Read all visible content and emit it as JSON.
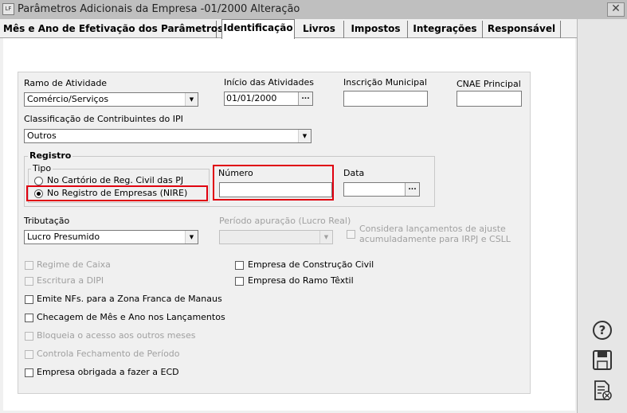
{
  "window": {
    "title": "Parâmetros Adicionais da Empresa -01/2000 Alteração",
    "app_badge": "LF",
    "close_label": "✕"
  },
  "tabs": [
    {
      "label": "Mês e Ano de Efetivação dos Parâmetros",
      "active": false
    },
    {
      "label": "Identificação",
      "active": true
    },
    {
      "label": "Livros",
      "active": false
    },
    {
      "label": "Impostos",
      "active": false
    },
    {
      "label": "Integrações",
      "active": false
    },
    {
      "label": "Responsável",
      "active": false
    }
  ],
  "form": {
    "ramo_label": "Ramo de Atividade",
    "ramo_value": "Comércio/Serviços",
    "inicio_label": "Início das Atividades",
    "inicio_value": "01/01/2000",
    "inscricao_label": "Inscrição Municipal",
    "inscricao_value": "",
    "cnae_label": "CNAE Principal",
    "cnae_value": "",
    "classificacao_label": "Classificação de Contribuintes do IPI",
    "classificacao_value": "Outros",
    "registro_title": "Registro",
    "tipo_title": "Tipo",
    "tipo_option1": "No Cartório de Reg. Civil das PJ",
    "tipo_option2": "No Registro de Empresas (NIRE)",
    "numero_label": "Número",
    "numero_value": "",
    "data_label": "Data",
    "data_value": "",
    "tributacao_label": "Tributação",
    "tributacao_value": "Lucro Presumido",
    "periodo_label": "Período apuração (Lucro Real)",
    "periodo_value": "",
    "considera_label_line1": "Considera lançamentos de ajuste",
    "considera_label_line2": "acumuladamente para IRPJ e CSLL",
    "ellipsis": "...",
    "checkboxes": [
      {
        "label": "Regime de Caixa",
        "enabled": false
      },
      {
        "label": "Escritura a DIPI",
        "enabled": false
      },
      {
        "label": "Emite NFs. para a Zona Franca de Manaus",
        "enabled": true
      },
      {
        "label": "Checagem de Mês e Ano nos Lançamentos",
        "enabled": true
      },
      {
        "label": "Bloqueia o acesso aos outros meses",
        "enabled": false
      },
      {
        "label": "Controla Fechamento de Período",
        "enabled": false
      },
      {
        "label": "Empresa obrigada a fazer a ECD",
        "enabled": true
      }
    ],
    "checkboxes_right": [
      {
        "label": "Empresa de Construção Civil",
        "enabled": true
      },
      {
        "label": "Empresa do Ramo Têxtil",
        "enabled": true
      }
    ]
  },
  "side_icons": [
    "help-icon",
    "save-icon",
    "cancel-document-icon"
  ],
  "highlight_color": "#e0000f"
}
